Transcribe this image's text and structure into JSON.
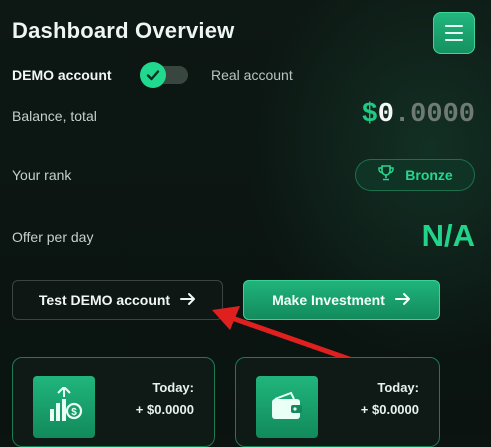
{
  "header": {
    "title": "Dashboard Overview",
    "menu_icon": "hamburger-icon"
  },
  "account_toggle": {
    "demo_label": "DEMO account",
    "real_label": "Real account",
    "selected": "demo"
  },
  "balance": {
    "label": "Balance, total",
    "currency": "$",
    "integer": "0",
    "fraction": ".0000"
  },
  "rank": {
    "label": "Your rank",
    "value": "Bronze",
    "icon": "trophy-icon"
  },
  "offer": {
    "label": "Offer per day",
    "value": "N/A"
  },
  "buttons": {
    "test_demo": "Test DEMO account",
    "make_investment": "Make Investment"
  },
  "cards": [
    {
      "icon": "growth-coin-icon",
      "today_label": "Today:",
      "amount": "+ $0.0000"
    },
    {
      "icon": "wallet-icon",
      "today_label": "Today:",
      "amount": "+ $0.0000"
    }
  ],
  "colors": {
    "accent": "#21d98e",
    "background": "#0b1411",
    "annotation_arrow": "#e0201e"
  }
}
